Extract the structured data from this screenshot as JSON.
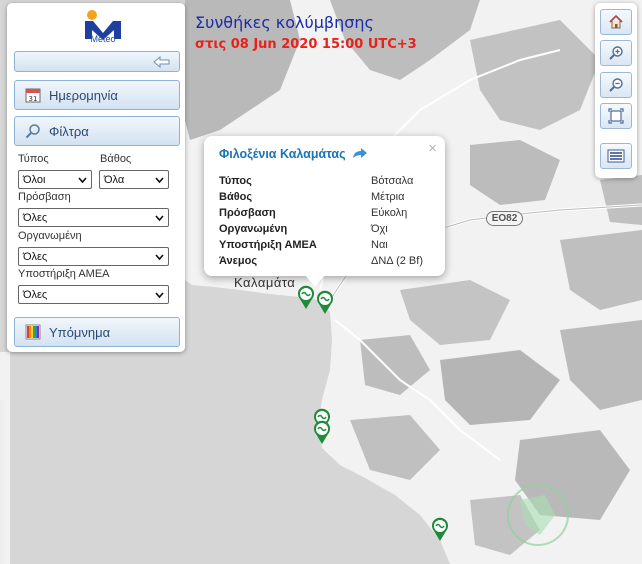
{
  "map": {
    "title": "Συνθήκες κολύμβησης",
    "subtitle": "στις 08 Jun 2020 15:00 UTC+3",
    "place_label": "Καλαμάτα",
    "road_label": "ΕΟ82"
  },
  "sidebar": {
    "logo_text": "Meteo",
    "date_label": "Ημερομηνία",
    "filters_label": "Φίλτρα",
    "legend_label": "Υπόμνημα",
    "filters": {
      "type": {
        "label": "Τύπος",
        "value": "Όλοι"
      },
      "depth": {
        "label": "Βάθος",
        "value": "Όλα"
      },
      "access": {
        "label": "Πρόσβαση",
        "value": "Όλες"
      },
      "organized": {
        "label": "Οργανωμένη",
        "value": "Όλες"
      },
      "amea": {
        "label": "Υποστήριξη ΑΜΕΑ",
        "value": "Όλες"
      }
    }
  },
  "popup": {
    "title": "Φιλοξένια Καλαμάτας",
    "close": "×",
    "rows": [
      {
        "key": "Τύπος",
        "value": "Βότσαλα"
      },
      {
        "key": "Βάθος",
        "value": "Μέτρια"
      },
      {
        "key": "Πρόσβαση",
        "value": "Εύκολη"
      },
      {
        "key": "Οργανωμένη",
        "value": "Όχι"
      },
      {
        "key": "Υποστήριξη ΑΜΕΑ",
        "value": "Ναι"
      },
      {
        "key": "Άνεμος",
        "value": "ΔΝΔ (2 Bf)"
      }
    ]
  },
  "colors": {
    "title": "#1a2da8",
    "subtitle": "#e8221b",
    "marker": "#1f8a3a",
    "sea": "#d6d6d6",
    "land": "#f2f2f2",
    "forest": "#b9b9b9"
  }
}
